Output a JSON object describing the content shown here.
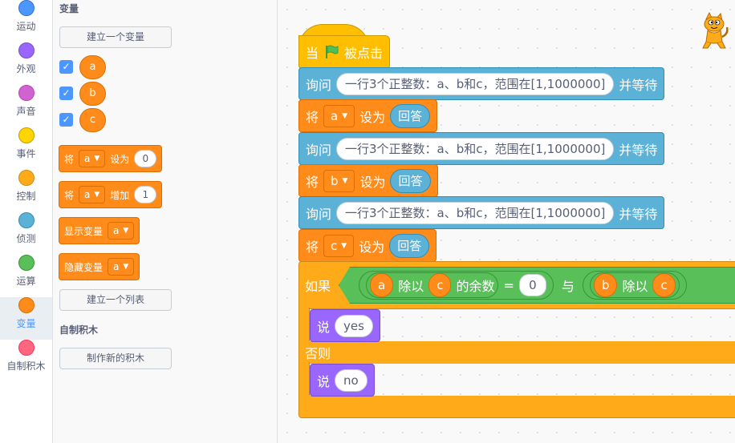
{
  "categories": [
    {
      "label": "运动",
      "color": "#4c97ff",
      "icon": "motion-dot-icon"
    },
    {
      "label": "外观",
      "color": "#9966ff",
      "icon": "looks-dot-icon"
    },
    {
      "label": "声音",
      "color": "#cf63cf",
      "icon": "sound-dot-icon"
    },
    {
      "label": "事件",
      "color": "#ffd500",
      "icon": "events-dot-icon"
    },
    {
      "label": "控制",
      "color": "#ffab19",
      "icon": "control-dot-icon"
    },
    {
      "label": "侦测",
      "color": "#5cb1d6",
      "icon": "sensing-dot-icon"
    },
    {
      "label": "运算",
      "color": "#59c059",
      "icon": "operators-dot-icon"
    },
    {
      "label": "变量",
      "color": "#ff8c1a",
      "icon": "variables-dot-icon",
      "selected": true
    },
    {
      "label": "自制积木",
      "color": "#ff6680",
      "icon": "my-blocks-dot-icon"
    }
  ],
  "palette": {
    "variables_title": "变量",
    "make_variable": "建立一个变量",
    "variables": [
      {
        "name": "a",
        "checked": true
      },
      {
        "name": "b",
        "checked": true
      },
      {
        "name": "c",
        "checked": true
      }
    ],
    "set_block": {
      "label": "将",
      "var": "a",
      "action": "设为",
      "value": "0"
    },
    "change_block": {
      "label": "将",
      "var": "a",
      "action": "增加",
      "value": "1"
    },
    "show_block": {
      "label": "显示变量",
      "var": "a"
    },
    "hide_block": {
      "label": "隐藏变量",
      "var": "a"
    },
    "make_list": "建立一个列表",
    "myblocks_title": "自制积木",
    "make_block": "制作新的积木"
  },
  "script": {
    "hat": {
      "when": "当",
      "clicked": "被点击",
      "flag_icon": "green-flag-icon"
    },
    "ask_label": "询问",
    "ask_prompt": "一行3个正整数：a、b和c，范围在[1,1000000]",
    "and_wait": "并等待",
    "set_label": "将",
    "set_to": "设为",
    "answer": "回答",
    "vars": [
      "a",
      "b",
      "c"
    ],
    "if_label": "如果",
    "mod_label": "除以",
    "remainder_label": "的余数",
    "equals": "=",
    "zero": "0",
    "and_label": "与",
    "say_label": "说",
    "say_yes": "yes",
    "else_label": "否则",
    "say_no": "no"
  },
  "colors": {
    "variables": "#ff8c1a",
    "sensing": "#5cb1d6",
    "looks": "#9966ff",
    "control": "#ffab19",
    "events": "#ffbf00",
    "operators": "#59c059"
  }
}
